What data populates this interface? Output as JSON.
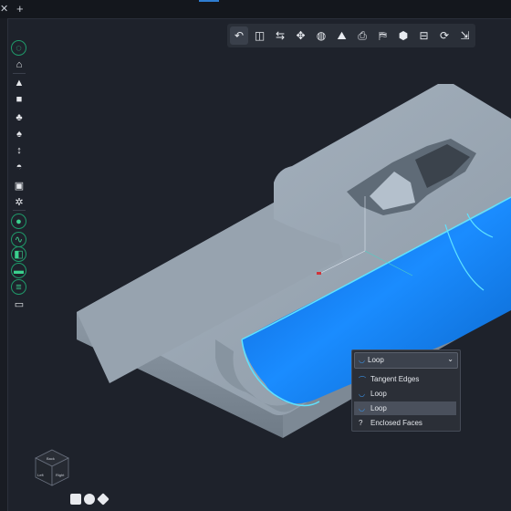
{
  "tabs": {
    "close_glyph": "✕",
    "add_glyph": "+"
  },
  "left_tools": [
    {
      "name": "sketch-circle-icon",
      "glyph": "◌",
      "ring": true
    },
    {
      "name": "plane-icon",
      "glyph": "⌂",
      "ring": false
    },
    {
      "name": "extrude-icon",
      "glyph": "▲",
      "ring": false
    },
    {
      "name": "box-icon",
      "glyph": "■",
      "ring": false
    },
    {
      "name": "revolve-icon",
      "glyph": "♣",
      "ring": false
    },
    {
      "name": "sweep-icon",
      "glyph": "♠",
      "ring": false
    },
    {
      "name": "pin-icon",
      "glyph": "↕",
      "ring": false
    },
    {
      "name": "fillet-icon",
      "glyph": "◓",
      "ring": false
    },
    {
      "name": "shell-icon",
      "glyph": "▣",
      "ring": false
    },
    {
      "name": "pattern-icon",
      "glyph": "✲",
      "ring": false
    },
    {
      "name": "point-icon",
      "glyph": "●",
      "ring": true
    },
    {
      "name": "curve-icon",
      "glyph": "∿",
      "ring": true
    },
    {
      "name": "surface-icon",
      "glyph": "◧",
      "ring": true
    },
    {
      "name": "section-icon",
      "glyph": "▬",
      "ring": true
    },
    {
      "name": "list-icon",
      "glyph": "≡",
      "ring": true
    },
    {
      "name": "comment-icon",
      "glyph": "▭",
      "ring": false
    }
  ],
  "top_tools": [
    {
      "name": "select-mode-icon",
      "glyph": "↶"
    },
    {
      "name": "measure-icon",
      "glyph": "◫"
    },
    {
      "name": "transform-icon",
      "glyph": "⇆"
    },
    {
      "name": "move-icon",
      "glyph": "✥"
    },
    {
      "name": "globe-icon",
      "glyph": "◍"
    },
    {
      "name": "terrain-icon",
      "glyph": "⛰"
    },
    {
      "name": "print-icon",
      "glyph": "⎙"
    },
    {
      "name": "map-icon",
      "glyph": "⛿"
    },
    {
      "name": "cube-icon",
      "glyph": "⬢"
    },
    {
      "name": "layers-icon",
      "glyph": "⊟"
    },
    {
      "name": "refresh-icon",
      "glyph": "⟳"
    },
    {
      "name": "export-icon",
      "glyph": "⇲"
    }
  ],
  "dropdown": {
    "selected": "Loop",
    "items": [
      {
        "label": "Tangent Edges",
        "icon": "tangent-edges-icon",
        "glyph": "⌒",
        "selected": false
      },
      {
        "label": "Loop",
        "icon": "loop-icon",
        "glyph": "◡",
        "selected": false
      },
      {
        "label": "Loop",
        "icon": "loop-icon",
        "glyph": "◡",
        "selected": true
      },
      {
        "label": "Enclosed Faces",
        "icon": "help-icon",
        "glyph": "?",
        "selected": false
      }
    ]
  },
  "viewcube": {
    "faces": [
      "Back",
      "Left",
      "Right"
    ]
  },
  "colors": {
    "selection_blue": "#1a8cff",
    "edge_cyan": "#5fe3ff",
    "part_gray": "#9aa7b4",
    "accent_green": "#3bd08e"
  }
}
